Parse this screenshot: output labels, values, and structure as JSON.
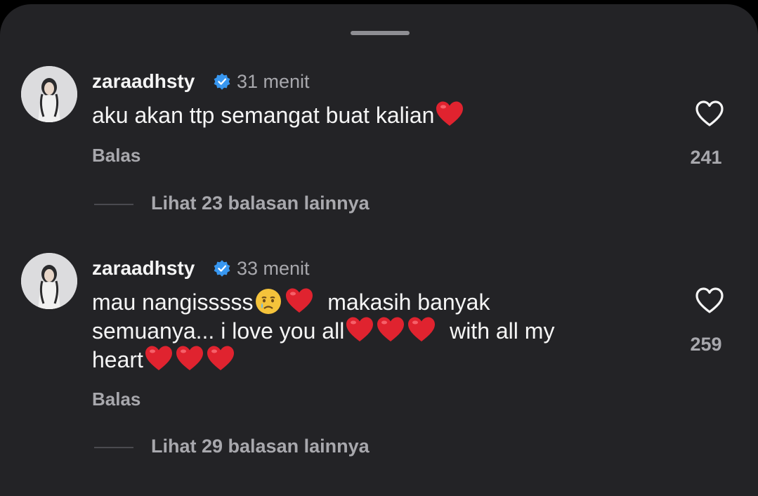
{
  "comments": [
    {
      "username": "zaraadhsty",
      "time": "31 menit",
      "text_parts": [
        "aku akan ttp semangat buat kalian"
      ],
      "reply_label": "Balas",
      "likes": "241",
      "view_replies": "Lihat 23 balasan lainnya"
    },
    {
      "username": "zaraadhsty",
      "time": "33 menit",
      "text_parts": [
        "mau nangisssss",
        "makasih banyak",
        "semuanya... i love you all",
        "with all my",
        "heart"
      ],
      "reply_label": "Balas",
      "likes": "259",
      "view_replies": "Lihat 29 balasan lainnya"
    }
  ],
  "icons": {
    "verified": "verified-badge-icon",
    "like": "heart-outline-icon",
    "emoji_heart": "red-heart-emoji",
    "emoji_cry": "crying-face-emoji"
  },
  "colors": {
    "sheet_bg": "#232326",
    "primary_text": "#f5f5f5",
    "secondary_text": "#a8a8ad",
    "verified_blue": "#3897f0",
    "heart_red": "#e0232f"
  }
}
